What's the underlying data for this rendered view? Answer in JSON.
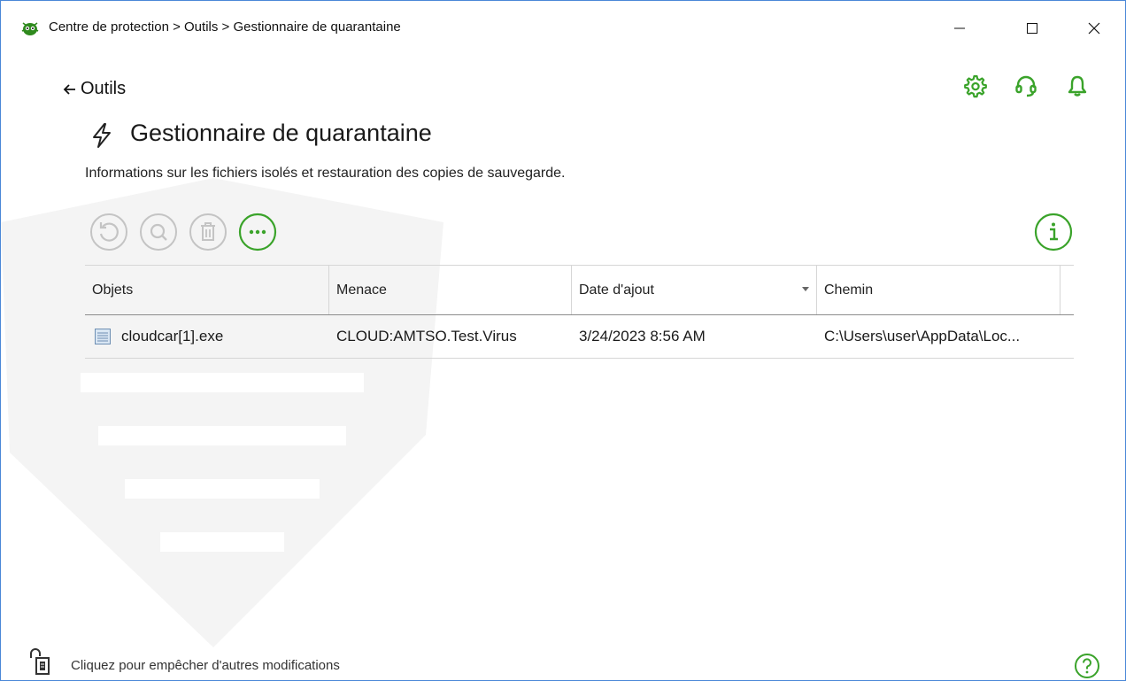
{
  "window": {
    "title": "Centre de protection > Outils > Gestionnaire de quarantaine",
    "app_icon": "dr-web-spider-icon",
    "controls": [
      "minimize-icon",
      "maximize-icon",
      "close-icon"
    ]
  },
  "nav": {
    "back_label": "Outils"
  },
  "top_icons": [
    "gear-icon",
    "headset-icon",
    "bell-icon"
  ],
  "page": {
    "icon": "lightning-icon",
    "title": "Gestionnaire de quarantaine",
    "description": "Informations sur les fichiers isolés et restauration des copies de sauvegarde."
  },
  "toolbar": {
    "buttons": [
      {
        "icon": "restore-icon",
        "enabled": false
      },
      {
        "icon": "scan-icon",
        "enabled": false
      },
      {
        "icon": "trash-icon",
        "enabled": false
      },
      {
        "icon": "more-icon",
        "enabled": true
      }
    ],
    "info_icon": "info-icon"
  },
  "table": {
    "columns": [
      "Objets",
      "Menace",
      "Date d'ajout",
      "Chemin"
    ],
    "sorted_column": "Date d'ajout",
    "rows": [
      {
        "object": "cloudcar[1].exe",
        "threat": "CLOUD:AMTSO.Test.Virus",
        "date": "3/24/2023 8:56 AM",
        "path": "C:\\Users\\user\\AppData\\Loc..."
      }
    ]
  },
  "footer": {
    "lock_label": "Cliquez pour empêcher d'autres modifications",
    "help_icon": "help-icon"
  },
  "colors": {
    "accent": "#3aa32a",
    "disabled": "#c4c4c4",
    "border": "#4a88d8"
  }
}
